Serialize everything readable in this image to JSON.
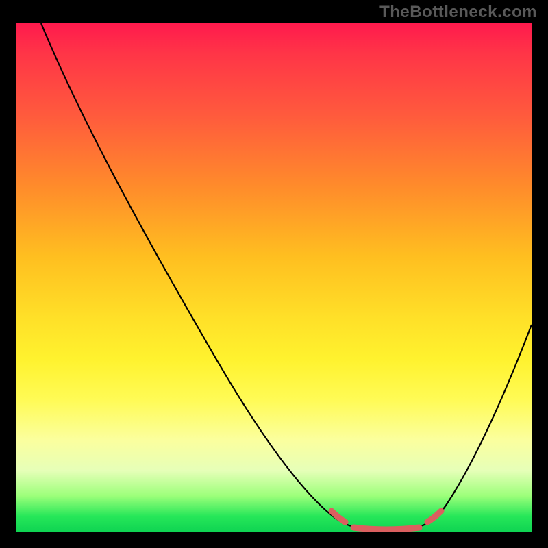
{
  "watermark": "TheBottleneck.com",
  "colors": {
    "background": "#000000",
    "gradient_top": "#ff1a4d",
    "gradient_mid": "#ffe028",
    "gradient_bottom": "#0fd452",
    "curve": "#000000",
    "accent": "#db5f5f",
    "watermark_text": "#595959"
  },
  "chart_data": {
    "type": "line",
    "title": "",
    "xlabel": "",
    "ylabel": "",
    "xlim": [
      0,
      100
    ],
    "ylim": [
      0,
      100
    ],
    "series": [
      {
        "name": "bottleneck-curve",
        "x": [
          0,
          5,
          10,
          15,
          20,
          25,
          30,
          35,
          40,
          45,
          50,
          55,
          60,
          62,
          65,
          70,
          75,
          80,
          82,
          85,
          90,
          95,
          100
        ],
        "y": [
          100,
          93,
          86,
          79,
          71,
          63,
          55,
          47,
          39,
          31,
          23,
          16,
          9,
          5,
          2,
          0,
          0,
          2,
          5,
          9,
          19,
          30,
          42
        ]
      }
    ],
    "annotations": [
      {
        "name": "optimal-flat-region",
        "x_range": [
          65,
          80
        ],
        "y": 0
      },
      {
        "name": "left-knee-marker",
        "x": 62.5,
        "y": 4.5
      },
      {
        "name": "right-knee-marker",
        "x": 81.5,
        "y": 4.5
      }
    ]
  }
}
